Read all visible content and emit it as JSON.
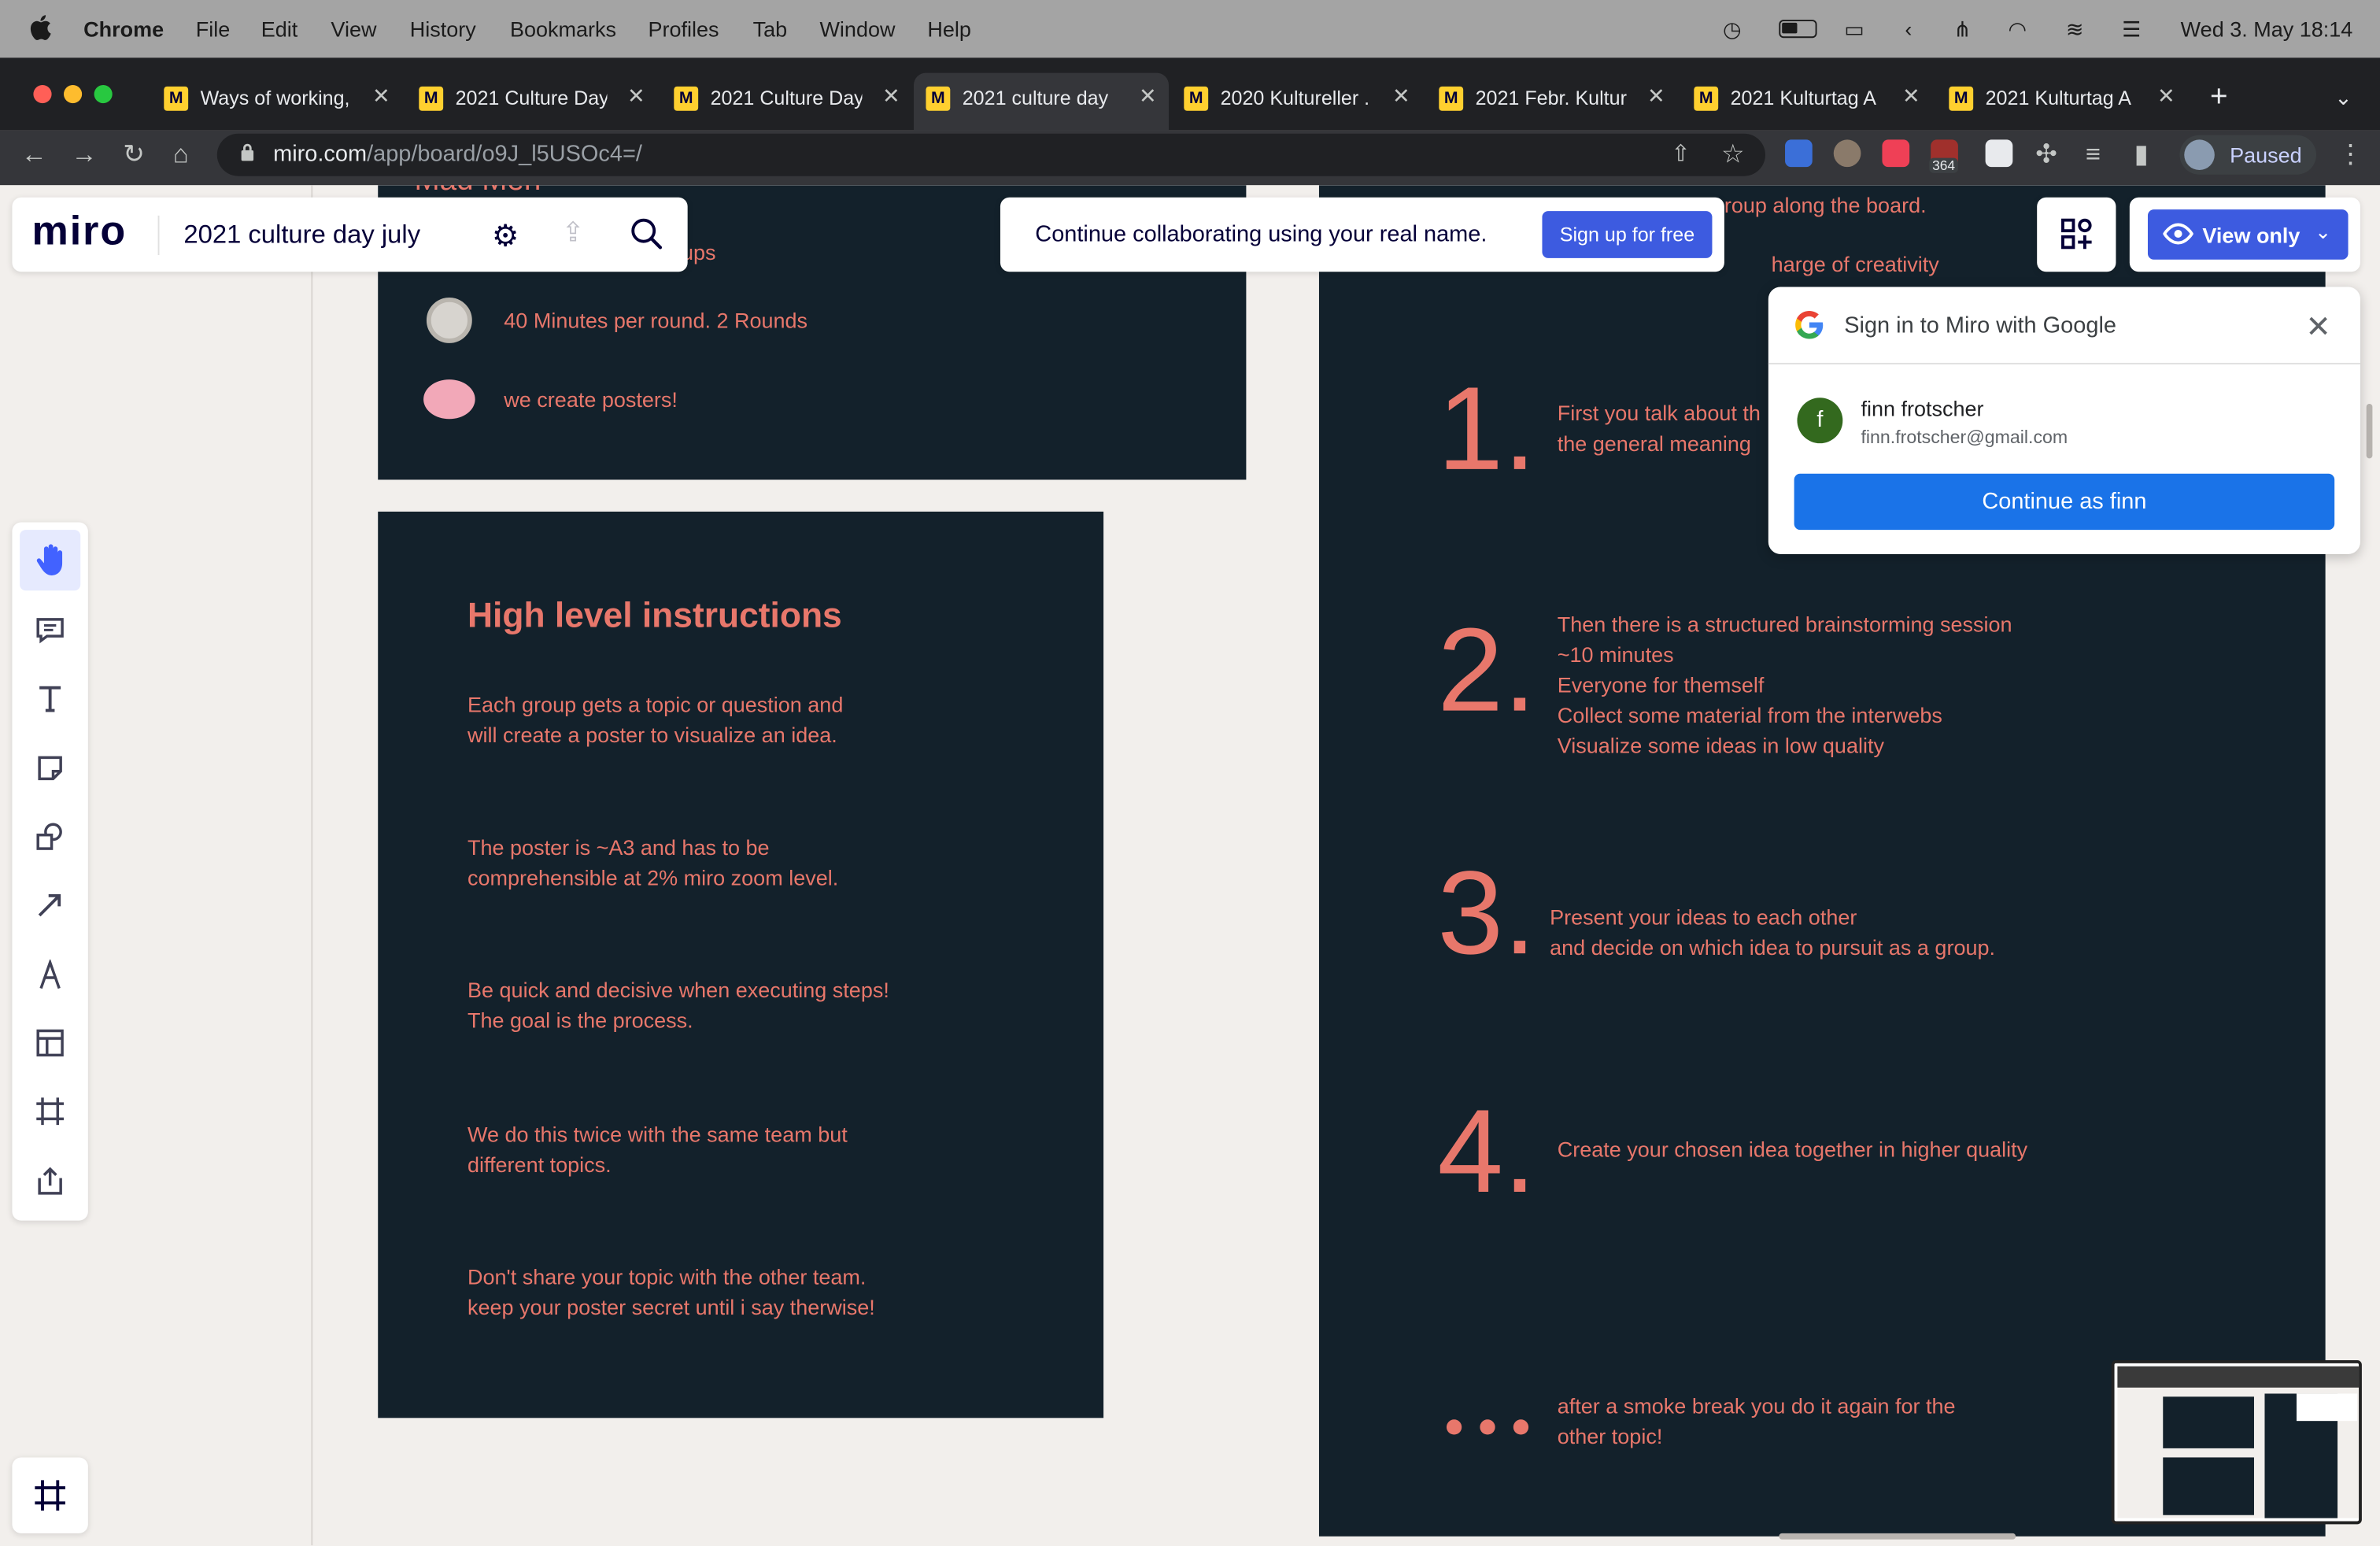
{
  "menubar": {
    "app": "Chrome",
    "items": [
      "File",
      "Edit",
      "View",
      "History",
      "Bookmarks",
      "Profiles",
      "Tab",
      "Window",
      "Help"
    ],
    "clock": "Wed 3. May  18:14"
  },
  "tabs": [
    {
      "title": "Ways of working,"
    },
    {
      "title": "2021 Culture Day"
    },
    {
      "title": "2021 Culture Day"
    },
    {
      "title": "2021 culture day"
    },
    {
      "title": "2020 Kultureller ."
    },
    {
      "title": "2021 Febr. Kultur"
    },
    {
      "title": "2021 Kulturtag A"
    },
    {
      "title": "2021 Kulturtag A"
    }
  ],
  "address": {
    "host": "miro.com",
    "path": "/app/board/o9J_l5USOc4=/"
  },
  "profile": {
    "label": "Paused",
    "badge": "364"
  },
  "miro": {
    "logo": "miro",
    "board_title": "2021 culture day july",
    "banner_text": "Continue collaborating using your real name.",
    "signup_label": "Sign up for free",
    "view_only_label": "View only"
  },
  "top_panel": {
    "cut_title": "Mad Men",
    "cut_line": "ups",
    "row1": "40 Minutes per round. 2 Rounds",
    "row2": "we create posters!"
  },
  "instructions": {
    "title": "High level instructions",
    "p1a": "Each group gets a topic or question and",
    "p1b": "will create a poster to visualize an idea.",
    "p2a": "The poster is ~A3 and has to be",
    "p2b": "comprehensible at 2% miro zoom level.",
    "p3a": "Be quick and decisive when executing steps!",
    "p3b": "The goal is the process.",
    "p4a": "We do this twice with the same team but",
    "p4b": "different topics.",
    "p5a": "Don't share your topic with the other team.",
    "p5b": "keep your poster secret until i say therwise!"
  },
  "steps": {
    "top_a": "roup along the board.",
    "top_b": "harge of creativity",
    "n1": "1.",
    "s1a": "First you talk about th",
    "s1b": "the general meaning",
    "n2": "2.",
    "s2": [
      "Then there is a structured brainstorming session",
      "~10 minutes",
      "Everyone for themself",
      "Collect some material from the interwebs",
      "Visualize some ideas in low quality"
    ],
    "n3": "3.",
    "s3a": "Present your ideas to each other",
    "s3b": "and decide on which idea to pursuit as a group.",
    "n4": "4.",
    "s4": "Create your chosen idea together in higher quality",
    "s5a": "after a smoke break you do it again for the",
    "s5b": "other topic!"
  },
  "google": {
    "title": "Sign in to Miro with Google",
    "initial": "f",
    "name": "finn frotscher",
    "email": "finn.frotscher@gmail.com",
    "button": "Continue as finn"
  },
  "colors": {
    "panel": "#13212b",
    "accent": "#e8776b",
    "miro_blue": "#4262ff"
  }
}
